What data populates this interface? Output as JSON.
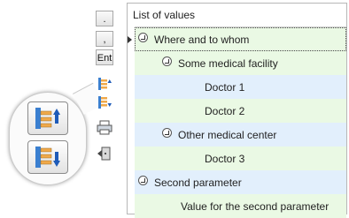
{
  "toolbar": {
    "dot_label": ".",
    "comma_label": ",",
    "enter_label": "Ent"
  },
  "grid": {
    "header": "List of values",
    "rows": [
      {
        "label": "Where and to whom"
      },
      {
        "label": "Some medical facility"
      },
      {
        "label": "Doctor 1"
      },
      {
        "label": "Doctor 2"
      },
      {
        "label": "Other medical center"
      },
      {
        "label": "Doctor 3"
      },
      {
        "label": "Second parameter"
      },
      {
        "label": "Value for the second parameter"
      }
    ]
  },
  "icons": [
    "expand-all-icon",
    "collapse-all-icon",
    "print-icon",
    "exit-icon",
    "expand-all-large-icon",
    "collapse-all-large-icon",
    "expand-node-icon",
    "current-row-arrow-icon"
  ],
  "colors": {
    "row_green": "#eaf9e4",
    "row_blue": "#e2effc",
    "accent_blue": "#2f6fc6"
  }
}
